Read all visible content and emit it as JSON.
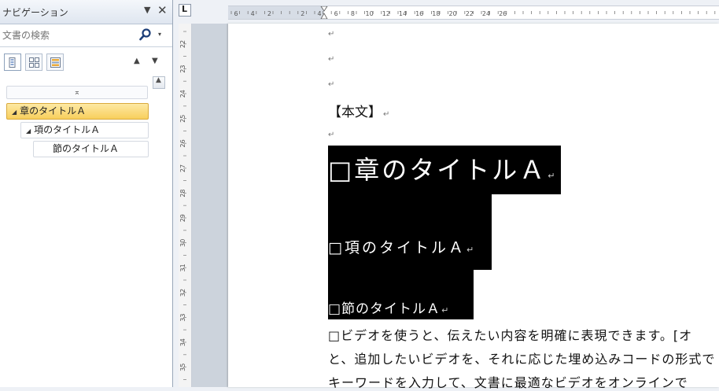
{
  "nav_pane": {
    "title": "ナビゲーション",
    "dropdown_glyph": "▼",
    "close_glyph": "✕",
    "search": {
      "placeholder": "文書の検索",
      "dropdown_glyph": "▾"
    },
    "view_tabs": [
      {
        "name": "headings-view",
        "icon": "document-headings-icon"
      },
      {
        "name": "pages-view",
        "icon": "thumbnails-grid-icon"
      },
      {
        "name": "results-view",
        "icon": "search-results-icon"
      }
    ],
    "nav_up_glyph": "▲",
    "nav_down_glyph": "▼",
    "collapse_glyph": "⌅",
    "scroll_up_glyph": "▲",
    "tree": [
      {
        "label": "章のタイトルＡ",
        "expander": "◢",
        "selected": true
      },
      {
        "label": "項のタイトルＡ",
        "expander": "◢"
      },
      {
        "label": "節のタイトルＡ"
      }
    ]
  },
  "ruler": {
    "toggle_glyph": "L",
    "h_labels": [
      "6",
      "4",
      "2",
      "2",
      "4",
      "6",
      "8",
      "10",
      "12",
      "14",
      "16",
      "18",
      "20",
      "22",
      "24",
      "26"
    ],
    "v_labels": [
      "22",
      "23",
      "24",
      "25",
      "26",
      "27",
      "28",
      "29",
      "30",
      "31",
      "32",
      "33",
      "34",
      "35"
    ]
  },
  "document": {
    "paragraph_mark": "↵",
    "honbun": "【本文】",
    "heading1": "□章のタイトルＡ",
    "heading2": "□項のタイトルＡ",
    "heading3": "□節のタイトルＡ",
    "body_lines": [
      "□ビデオを使うと、伝えたい内容を明確に表現できます。[オ",
      "と、追加したいビデオを、それに応じた埋め込みコードの形式で",
      "キーワードを入力して、文書に最適なビデオをオンラインで"
    ]
  },
  "colors": {
    "selected_item": "#f8cf5c",
    "heading_background": "#000000",
    "doc_background": "#ccd3dc"
  }
}
